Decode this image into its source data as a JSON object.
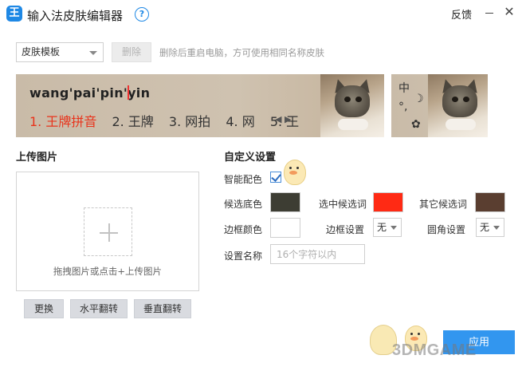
{
  "window": {
    "title": "输入法皮肤编辑器",
    "app_icon_glyph": "王",
    "help_glyph": "?",
    "feedback": "反馈",
    "close_glyph": "✕"
  },
  "toolbar": {
    "skin_template": "皮肤模板",
    "delete": "删除",
    "hint": "删除后重启电脑，方可使用相同名称皮肤"
  },
  "preview": {
    "pinyin": "wang'pai'pin'yin",
    "candidates": [
      "1. 王牌拼音",
      "2. 王牌",
      "3. 网拍",
      "4. 网",
      "5. 王"
    ],
    "selected_index": 0,
    "page_arrows": "◀ ▶",
    "status_bar": {
      "lang": "中",
      "punct": "°,",
      "moon": "☽",
      "gear": "✿"
    }
  },
  "upload": {
    "title": "上传图片",
    "hint": "拖拽图片或点击+上传图片",
    "buttons": [
      "更换",
      "水平翻转",
      "垂直翻转"
    ]
  },
  "custom": {
    "title": "自定义设置",
    "smart_color": {
      "label": "智能配色",
      "checked": true
    },
    "candidate_bg": {
      "label": "候选底色",
      "color": "#3d3d33"
    },
    "selected_candidate": {
      "label": "选中候选词",
      "color": "#ff2a14"
    },
    "other_candidate": {
      "label": "其它候选词",
      "color": "#5a3e30"
    },
    "border_color": {
      "label": "边框颜色",
      "color": "#ffffff"
    },
    "border_setting": {
      "label": "边框设置",
      "value": "无"
    },
    "corner_setting": {
      "label": "圆角设置",
      "value": "无"
    },
    "setting_name": {
      "label": "设置名称",
      "placeholder": "16个字符以内"
    }
  },
  "apply": "应用",
  "watermark": "3DMGAME",
  "colors": {
    "accent": "#3296ef",
    "selected_text": "#e8341c",
    "preview_bg": "#cfc2b0"
  },
  "icons": [
    "app-logo-icon",
    "help-icon",
    "minimize-icon",
    "close-icon",
    "dropdown-caret-icon",
    "plus-icon",
    "checkmark-icon",
    "cat-photo",
    "mascot-icon"
  ]
}
